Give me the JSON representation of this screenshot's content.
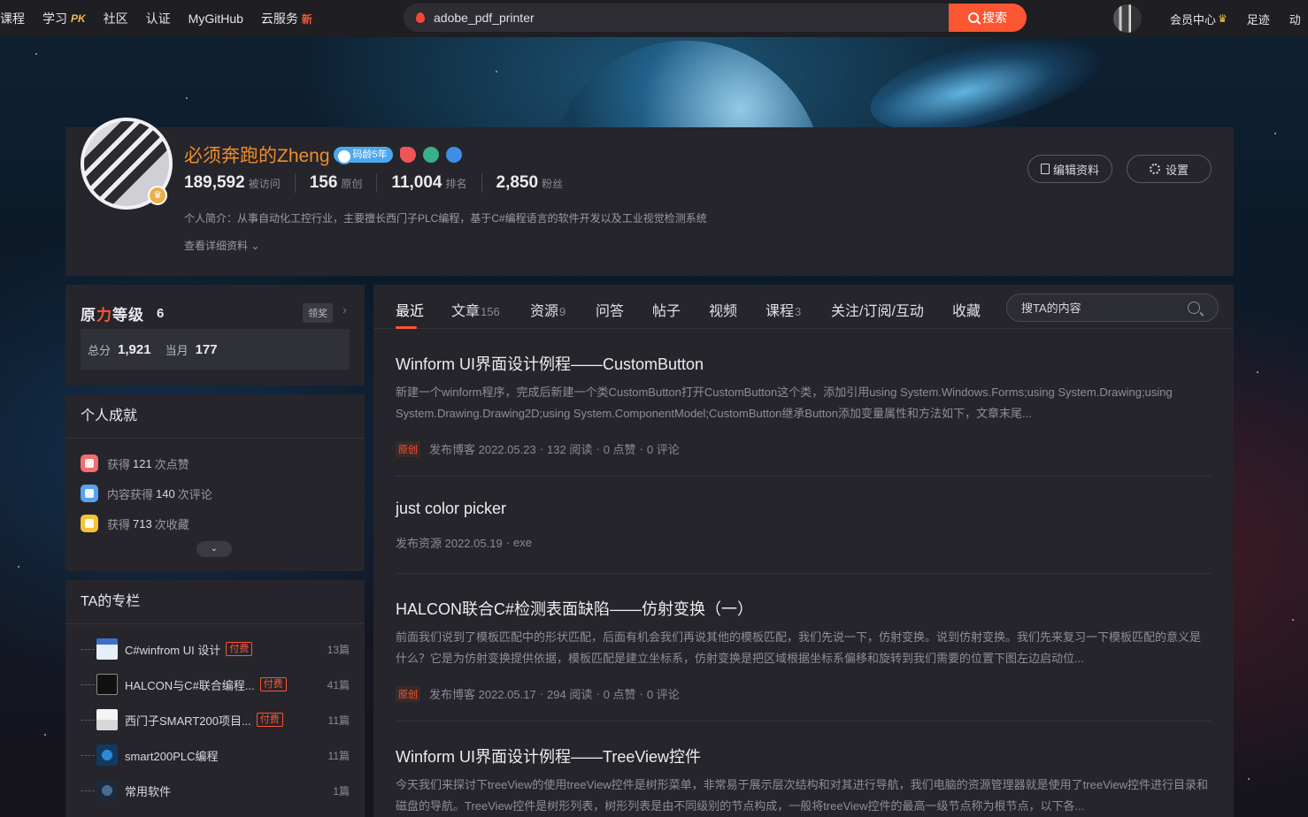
{
  "topnav": {
    "links": [
      "课程",
      "学习",
      "社区",
      "认证",
      "MyGitHub",
      "云服务"
    ],
    "learn_badge": "PK",
    "cloud_badge": "新",
    "search_value": "adobe_pdf_printer",
    "search_button": "搜索",
    "member_center": "会员中心",
    "footprint": "足迹",
    "dynamic": "动"
  },
  "profile": {
    "name": "必须奔跑的Zheng",
    "age_badge": "码龄5年",
    "stats": [
      {
        "num": "189,592",
        "label": "被访问"
      },
      {
        "num": "156",
        "label": "原创"
      },
      {
        "num": "11,004",
        "label": "排名"
      },
      {
        "num": "2,850",
        "label": "粉丝"
      }
    ],
    "bio": "个人简介：从事自动化工控行业，主要擅长西门子PLC编程，基于C#编程语言的软件开发以及工业视觉检测系统",
    "more": "查看详细资料",
    "edit_button": "编辑资料",
    "settings_button": "设置"
  },
  "level": {
    "brand_a": "原",
    "brand_b": "力",
    "brand_c": "等级",
    "level": "6",
    "reward": "领奖",
    "total_label": "总分",
    "total": "1,921",
    "month_label": "当月",
    "month": "177"
  },
  "achievements": {
    "title": "个人成就",
    "items": [
      {
        "pre": "获得",
        "num": "121",
        "post": "次点赞"
      },
      {
        "pre": "内容获得",
        "num": "140",
        "post": "次评论"
      },
      {
        "pre": "获得",
        "num": "713",
        "post": "次收藏"
      }
    ]
  },
  "columns": {
    "title": "TA的专栏",
    "paid_label": "付费",
    "items": [
      {
        "name": "C#winfrom UI 设计",
        "paid": true,
        "count": "13篇"
      },
      {
        "name": "HALCON与C#联合编程...",
        "paid": true,
        "count": "41篇"
      },
      {
        "name": "西门子SMART200项目...",
        "paid": true,
        "count": "11篇"
      },
      {
        "name": "smart200PLC编程",
        "paid": false,
        "count": "11篇"
      },
      {
        "name": "常用软件",
        "paid": false,
        "count": "1篇"
      }
    ]
  },
  "tabs": {
    "items": [
      {
        "label": "最近",
        "count": ""
      },
      {
        "label": "文章",
        "count": "156"
      },
      {
        "label": "资源",
        "count": "9"
      },
      {
        "label": "问答",
        "count": ""
      },
      {
        "label": "帖子",
        "count": ""
      },
      {
        "label": "视频",
        "count": ""
      },
      {
        "label": "课程",
        "count": "3"
      },
      {
        "label": "关注/订阅/互动",
        "count": ""
      },
      {
        "label": "收藏",
        "count": ""
      }
    ],
    "search_placeholder": "搜TA的内容"
  },
  "articles": [
    {
      "title": "Winform UI界面设计例程——CustomButton",
      "desc": "新建一个winform程序，完成后新建一个类CustomButton打开CustomButton这个类，添加引用using System.Windows.Forms;using System.Drawing;using System.Drawing.Drawing2D;using System.ComponentModel;CustomButton继承Button添加变量属性和方法如下，文章末尾...",
      "tag": "原创",
      "published": "发布博客 2022.05.23",
      "reads": "132 阅读",
      "likes": "0 点赞",
      "comments": "0 评论"
    },
    {
      "title": "just color picker",
      "published": "发布资源 2022.05.19",
      "ext": "exe"
    },
    {
      "title": "HALCON联合C#检测表面缺陷——仿射变换（一）",
      "desc": "前面我们说到了模板匹配中的形状匹配，后面有机会我们再说其他的模板匹配，我们先说一下，仿射变换。说到仿射变换。我们先来复习一下模板匹配的意义是什么？它是为仿射变换提供依据，模板匹配是建立坐标系，仿射变换是把区域根据坐标系偏移和旋转到我们需要的位置下图左边启动位...",
      "tag": "原创",
      "published": "发布博客 2022.05.17",
      "reads": "294 阅读",
      "likes": "0 点赞",
      "comments": "0 评论"
    },
    {
      "title": "Winform UI界面设计例程——TreeView控件",
      "desc": "今天我们来探讨下treeView的使用treeView控件是树形菜单，非常易于展示层次结构和对其进行导航，我们电脑的资源管理器就是使用了treeView控件进行目录和磁盘的导航。TreeView控件是树形列表，树形列表是由不同级别的节点构成，一般将treeView控件的最高一级节点称为根节点，以下各..."
    }
  ],
  "colors": {
    "accent": "#fc5531",
    "name": "#f08c2a",
    "card": "#25252b",
    "nav": "#1e1e23"
  }
}
